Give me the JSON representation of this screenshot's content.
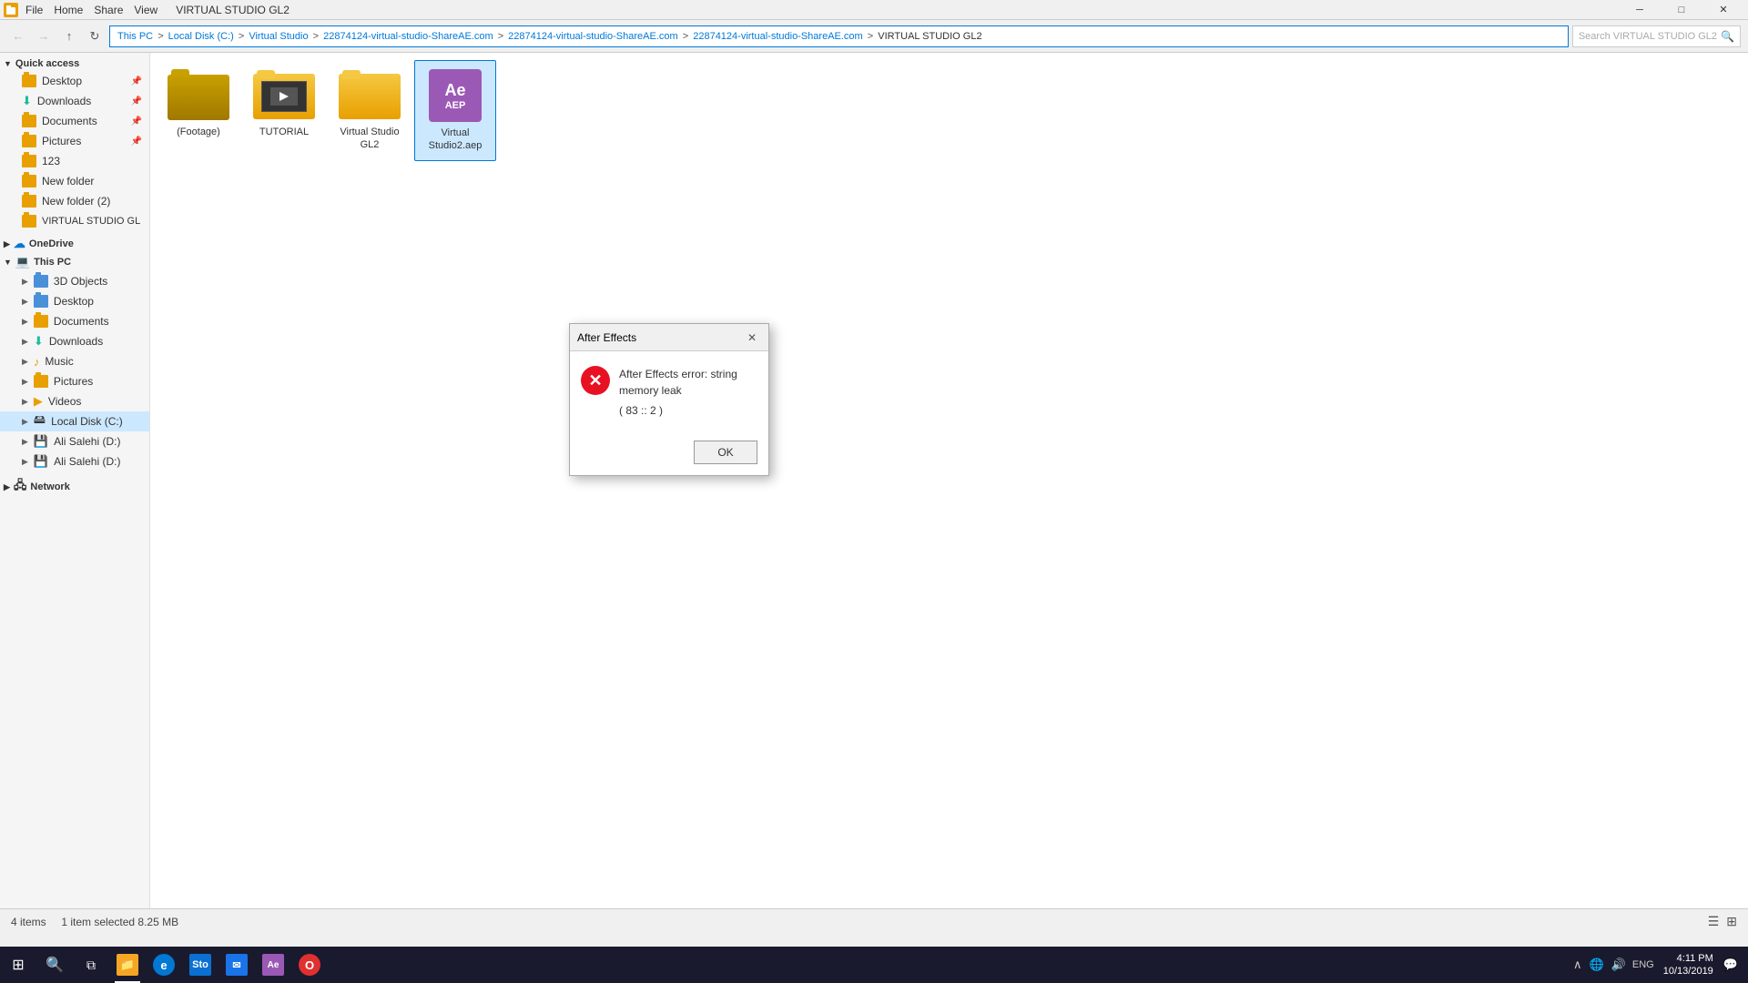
{
  "window": {
    "title": "VIRTUAL STUDIO GL2",
    "icon": "folder-icon"
  },
  "ribbon": {
    "tabs": [
      "File",
      "Home",
      "Share",
      "View"
    ],
    "active_tab": "Home"
  },
  "address_bar": {
    "path": "This PC > Local Disk (C:) > Virtual Studio > 22874124-virtual-studio-ShareAE.com > 22874124-virtual-studio-ShareAE.com > 22874124-virtual-studio-ShareAE.com > VIRTUAL STUDIO GL2",
    "search_placeholder": "Search VIRTUAL STUDIO GL2"
  },
  "sidebar": {
    "quick_access_label": "Quick access",
    "quick_access_items": [
      {
        "label": "Desktop",
        "pinned": true
      },
      {
        "label": "Downloads",
        "pinned": true
      },
      {
        "label": "Documents",
        "pinned": true
      },
      {
        "label": "Pictures",
        "pinned": true
      },
      {
        "label": "123"
      },
      {
        "label": "New folder"
      },
      {
        "label": "New folder (2)"
      },
      {
        "label": "VIRTUAL STUDIO GL"
      }
    ],
    "onedrive_label": "OneDrive",
    "this_pc_label": "This PC",
    "this_pc_items": [
      {
        "label": "3D Objects"
      },
      {
        "label": "Desktop"
      },
      {
        "label": "Documents"
      },
      {
        "label": "Downloads"
      },
      {
        "label": "Music"
      },
      {
        "label": "Pictures"
      },
      {
        "label": "Videos"
      },
      {
        "label": "Local Disk (C:)",
        "selected": true
      },
      {
        "label": "Ali Salehi (D:)"
      },
      {
        "label": "Ali Salehi (D:)"
      }
    ],
    "network_label": "Network"
  },
  "content": {
    "items": [
      {
        "label": "(Footage)",
        "type": "folder-footage"
      },
      {
        "label": "TUTORIAL",
        "type": "folder-thumb"
      },
      {
        "label": "Virtual Studio GL2",
        "type": "folder"
      },
      {
        "label": "Virtual Studio2.aep",
        "type": "aep",
        "selected": true
      }
    ]
  },
  "status_bar": {
    "item_count": "4 items",
    "selected_info": "1 item selected  8.25 MB"
  },
  "dialog": {
    "title": "After Effects",
    "error_message": "After Effects error: string memory leak",
    "error_code": "( 83 :: 2 )",
    "ok_label": "OK"
  },
  "taskbar": {
    "apps": [
      {
        "name": "Windows Start",
        "icon": "⊞"
      },
      {
        "name": "Search",
        "icon": "🔍"
      },
      {
        "name": "Task View",
        "icon": "⧉"
      },
      {
        "name": "File Explorer",
        "color": "#f5a623"
      },
      {
        "name": "Edge",
        "color": "#0078d4"
      },
      {
        "name": "Store",
        "color": "#0a70d2"
      },
      {
        "name": "Mail",
        "color": "#1a73e8"
      },
      {
        "name": "After Effects",
        "color": "#9b59b6"
      },
      {
        "name": "Opera",
        "color": "#e03030"
      }
    ],
    "time": "4:11 PM",
    "date": "10/13/2019"
  }
}
